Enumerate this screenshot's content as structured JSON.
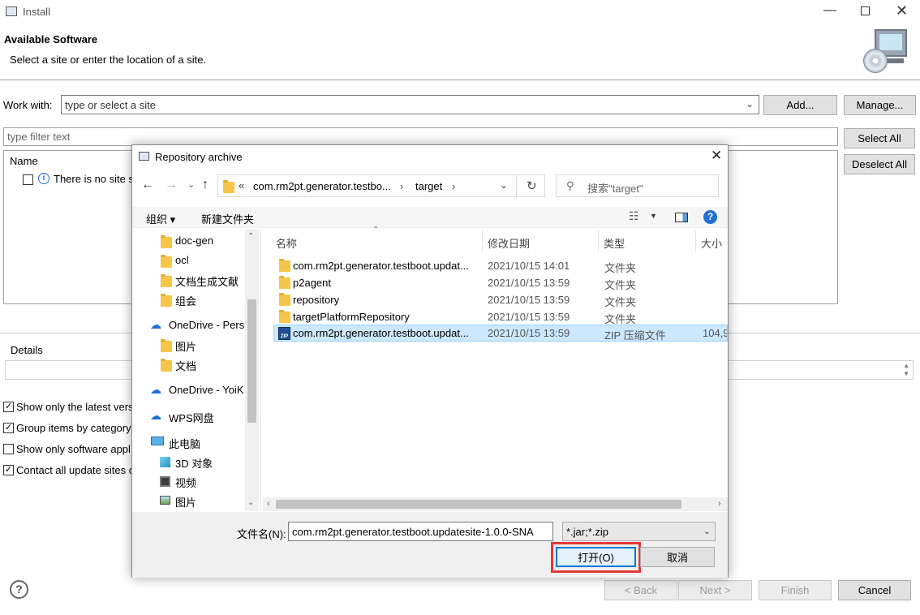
{
  "window": {
    "title": "Install"
  },
  "header": {
    "heading": "Available Software",
    "subtitle": "Select a site or enter the location of a site."
  },
  "work_with": {
    "label": "Work with:",
    "placeholder": "type or select a site",
    "add_label": "Add...",
    "manage_label": "Manage..."
  },
  "filter": {
    "placeholder": "type filter text",
    "select_all": "Select All",
    "deselect_all": "Deselect All"
  },
  "tree": {
    "column_name": "Name",
    "empty_message": "There is no site s"
  },
  "details": {
    "label": "Details"
  },
  "options": [
    {
      "label": "Show only the latest vers",
      "checked": true
    },
    {
      "label": "Group items by category",
      "checked": true
    },
    {
      "label": "Show only software appl",
      "checked": false
    },
    {
      "label": "Contact all update sites c",
      "checked": true
    }
  ],
  "footer": {
    "back": "< Back",
    "next": "Next >",
    "finish": "Finish",
    "cancel": "Cancel"
  },
  "dialog": {
    "title": "Repository archive",
    "breadcrumb": {
      "overflow": "«",
      "segment1": "com.rm2pt.generator.testbo...",
      "segment2": "target"
    },
    "search_placeholder": "搜索\"target\"",
    "toolbar": {
      "organize": "组织 ▾",
      "new_folder": "新建文件夹"
    },
    "nav_items": [
      {
        "label": "doc-gen",
        "icon": "folder-icon"
      },
      {
        "label": "ocl",
        "icon": "folder-icon"
      },
      {
        "label": "文档生成文献",
        "icon": "folder-icon"
      },
      {
        "label": "组会",
        "icon": "folder-icon"
      },
      {
        "label": "OneDrive - Perso",
        "icon": "cloud-icon"
      },
      {
        "label": "图片",
        "icon": "folder-icon"
      },
      {
        "label": "文档",
        "icon": "folder-icon"
      },
      {
        "label": "OneDrive - YoiK",
        "icon": "cloud-icon"
      },
      {
        "label": "WPS网盘",
        "icon": "cloud-icon"
      },
      {
        "label": "此电脑",
        "icon": "computer-icon"
      },
      {
        "label": "3D 对象",
        "icon": "cube-icon"
      },
      {
        "label": "视频",
        "icon": "video-icon"
      },
      {
        "label": "图片",
        "icon": "picture-icon"
      }
    ],
    "columns": {
      "name": "名称",
      "date": "修改日期",
      "type": "类型",
      "size": "大小"
    },
    "files": [
      {
        "name": "com.rm2pt.generator.testboot.updat...",
        "date": "2021/10/15 14:01",
        "type": "文件夹",
        "size": ""
      },
      {
        "name": "p2agent",
        "date": "2021/10/15 13:59",
        "type": "文件夹",
        "size": ""
      },
      {
        "name": "repository",
        "date": "2021/10/15 13:59",
        "type": "文件夹",
        "size": ""
      },
      {
        "name": "targetPlatformRepository",
        "date": "2021/10/15 13:59",
        "type": "文件夹",
        "size": ""
      },
      {
        "name": "com.rm2pt.generator.testboot.updat...",
        "date": "2021/10/15 13:59",
        "type": "ZIP 压缩文件",
        "size": "104,9"
      }
    ],
    "filename_label": "文件名(N):",
    "filename_value": "com.rm2pt.generator.testboot.updatesite-1.0.0-SNA",
    "filetype_value": "*.jar;*.zip",
    "open_label": "打开(O)",
    "cancel_label": "取消"
  },
  "colors": {
    "selection": "#cce8ff",
    "highlight": "#e53935",
    "accent": "#0078d7"
  }
}
